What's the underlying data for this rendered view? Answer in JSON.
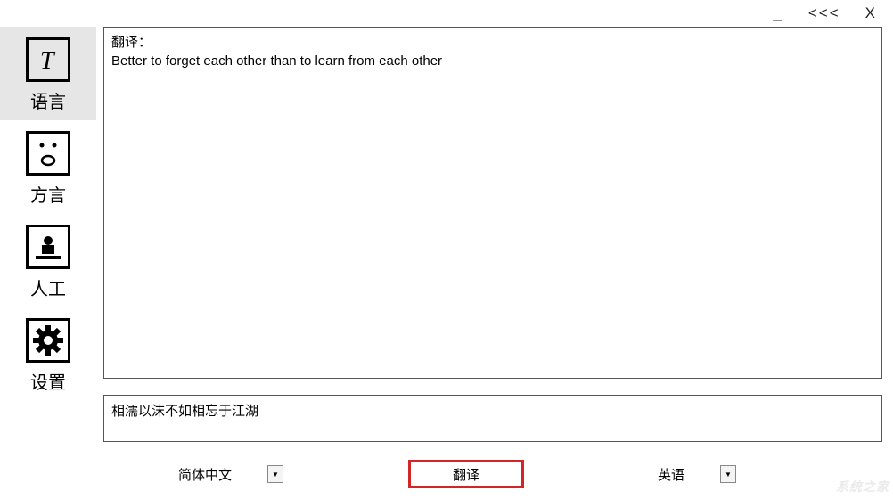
{
  "titlebar": {
    "minimize": "_",
    "back": "<<<",
    "close": "X"
  },
  "sidebar": {
    "items": [
      {
        "label": "语言",
        "icon": "text-icon",
        "active": true
      },
      {
        "label": "方言",
        "icon": "face-icon",
        "active": false
      },
      {
        "label": "人工",
        "icon": "person-pin-icon",
        "active": false
      },
      {
        "label": "设置",
        "icon": "gear-icon",
        "active": false
      }
    ]
  },
  "output": {
    "header_line": "翻译：",
    "translated_text": "Better to forget each other than to learn from each other"
  },
  "input": {
    "text": "相濡以沫不如相忘于江湖"
  },
  "controls": {
    "source_lang": "简体中文",
    "target_lang": "英语",
    "translate_label": "翻译"
  },
  "watermark": "系统之家"
}
